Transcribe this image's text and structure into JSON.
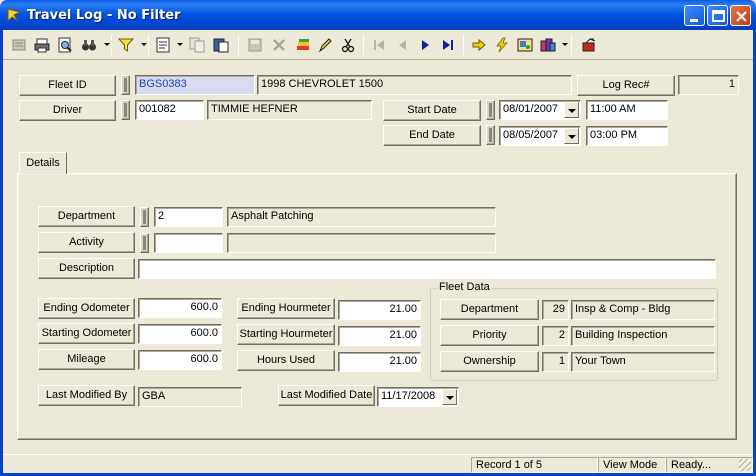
{
  "window": {
    "title": "Travel Log - No Filter"
  },
  "toolbar": {
    "icons": [
      "record-icon",
      "print-icon",
      "print-preview-icon",
      "binoculars-icon",
      "filter-icon",
      "report-icon",
      "copy-icon",
      "paste-icon",
      "save-icon",
      "delete-icon",
      "layers-icon",
      "edit-icon",
      "cut-icon",
      "first-record-icon",
      "previous-record-icon",
      "next-record-icon",
      "last-record-icon",
      "goto-icon",
      "lightning-icon",
      "picture-icon",
      "books-icon",
      "export-icon"
    ]
  },
  "header": {
    "fleet_id_label": "Fleet ID",
    "fleet_id_value": "BGS0383",
    "fleet_desc": "1998 CHEVROLET 1500",
    "log_rec_label": "Log Rec#",
    "log_rec_value": "1",
    "driver_label": "Driver",
    "driver_id": "001082",
    "driver_name": "TIMMIE HEFNER",
    "start_date_label": "Start Date",
    "start_date": "08/01/2007",
    "start_time": "11:00 AM",
    "end_date_label": "End Date",
    "end_date": "08/05/2007",
    "end_time": "03:00 PM"
  },
  "tabs": [
    {
      "label": "Details"
    }
  ],
  "details": {
    "department_label": "Department",
    "department_code": "2",
    "department_name": "Asphalt Patching",
    "activity_label": "Activity",
    "activity_code": "",
    "activity_name": "",
    "description_label": "Description",
    "description_value": "",
    "ending_odometer_label": "Ending Odometer",
    "ending_odometer": "600.0",
    "starting_odometer_label": "Starting Odometer",
    "starting_odometer": "600.0",
    "mileage_label": "Mileage",
    "mileage": "600.0",
    "ending_hourmeter_label": "Ending Hourmeter",
    "ending_hourmeter": "21.00",
    "starting_hourmeter_label": "Starting Hourmeter",
    "starting_hourmeter": "21.00",
    "hours_used_label": "Hours Used",
    "hours_used": "21.00",
    "last_modified_by_label": "Last Modified By",
    "last_modified_by": "GBA",
    "last_modified_date_label": "Last Modified Date",
    "last_modified_date": "11/17/2008"
  },
  "fleet_data": {
    "title": "Fleet Data",
    "department_label": "Department",
    "department_code": "29",
    "department_name": "Insp & Comp - Bldg",
    "priority_label": "Priority",
    "priority_code": "2",
    "priority_name": "Building Inspection",
    "ownership_label": "Ownership",
    "ownership_code": "1",
    "ownership_name": "Your Town"
  },
  "statusbar": {
    "record": "Record 1 of 5",
    "mode": "View Mode",
    "state": "Ready..."
  }
}
